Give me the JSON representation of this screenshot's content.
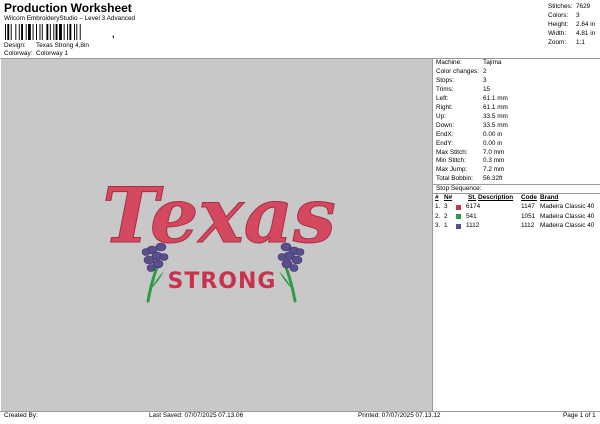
{
  "header": {
    "title": "Production Worksheet",
    "subtitle": "Wilcom EmbroideryStudio – Level 3 Advanced",
    "design_label": "Design:",
    "design_value": "Texas Strong 4,8in",
    "colorway_label": "Colorway:",
    "colorway_value": "Colorway 1"
  },
  "summary": [
    {
      "label": "Stitches:",
      "value": "7629"
    },
    {
      "label": "Colors:",
      "value": "3"
    },
    {
      "label": "Height:",
      "value": "2.64 in"
    },
    {
      "label": "Width:",
      "value": "4.81 in"
    },
    {
      "label": "Zoom:",
      "value": "1:1"
    }
  ],
  "machine": [
    {
      "label": "Machine:",
      "value": "Tajima"
    },
    {
      "label": "Color changes:",
      "value": "2"
    },
    {
      "label": "Stops:",
      "value": "3"
    },
    {
      "label": "Trims:",
      "value": "15"
    },
    {
      "label": "Left:",
      "value": "61.1 mm"
    },
    {
      "label": "Right:",
      "value": "61.1 mm"
    },
    {
      "label": "Up:",
      "value": "33.5 mm"
    },
    {
      "label": "Down:",
      "value": "33.5 mm"
    },
    {
      "label": "EndX:",
      "value": "0.00 in"
    },
    {
      "label": "EndY:",
      "value": "0.00 in"
    },
    {
      "label": "Max Stitch:",
      "value": "7.0 mm"
    },
    {
      "label": "Min Stitch:",
      "value": "0.3 mm"
    },
    {
      "label": "Max Jump:",
      "value": "7.2 mm"
    },
    {
      "label": "Total Bobbin:",
      "value": "56.32ft"
    }
  ],
  "stop_sequence": {
    "title": "Stop Sequence:",
    "headers": {
      "index": "#",
      "needle": "N#",
      "stitches": "St.",
      "description": "Description",
      "code": "Code",
      "brand": "Brand"
    },
    "rows": [
      {
        "index": "1.",
        "needle": "3",
        "color": "#c8324a",
        "thread": "6174",
        "stitches": "1147",
        "brand": "Madeira Classic 40"
      },
      {
        "index": "2.",
        "needle": "2",
        "color": "#2e9a4a",
        "thread": "541",
        "stitches": "1051",
        "brand": "Madeira Classic 40"
      },
      {
        "index": "3.",
        "needle": "1",
        "color": "#5a4e8c",
        "thread": "1112",
        "stitches": "1112",
        "brand": "Madeira Classic 40"
      }
    ]
  },
  "design": {
    "main_text": "Texas",
    "sub_text": "STRONG",
    "main_color": "#d4495f",
    "sub_color": "#c8324a",
    "stem_color": "#2e9a4a",
    "flower_color": "#5a4e8c"
  },
  "footer": {
    "created_by": "Created By:",
    "last_saved": "Last Saved: 07/07/2025 07.13.06",
    "printed": "Printed: 07/07/2025 07.13.12",
    "page": "Page 1 of 1"
  },
  "colors": {
    "canvas_bg": "#c8c8c8",
    "rule": "#9a9a9a"
  }
}
